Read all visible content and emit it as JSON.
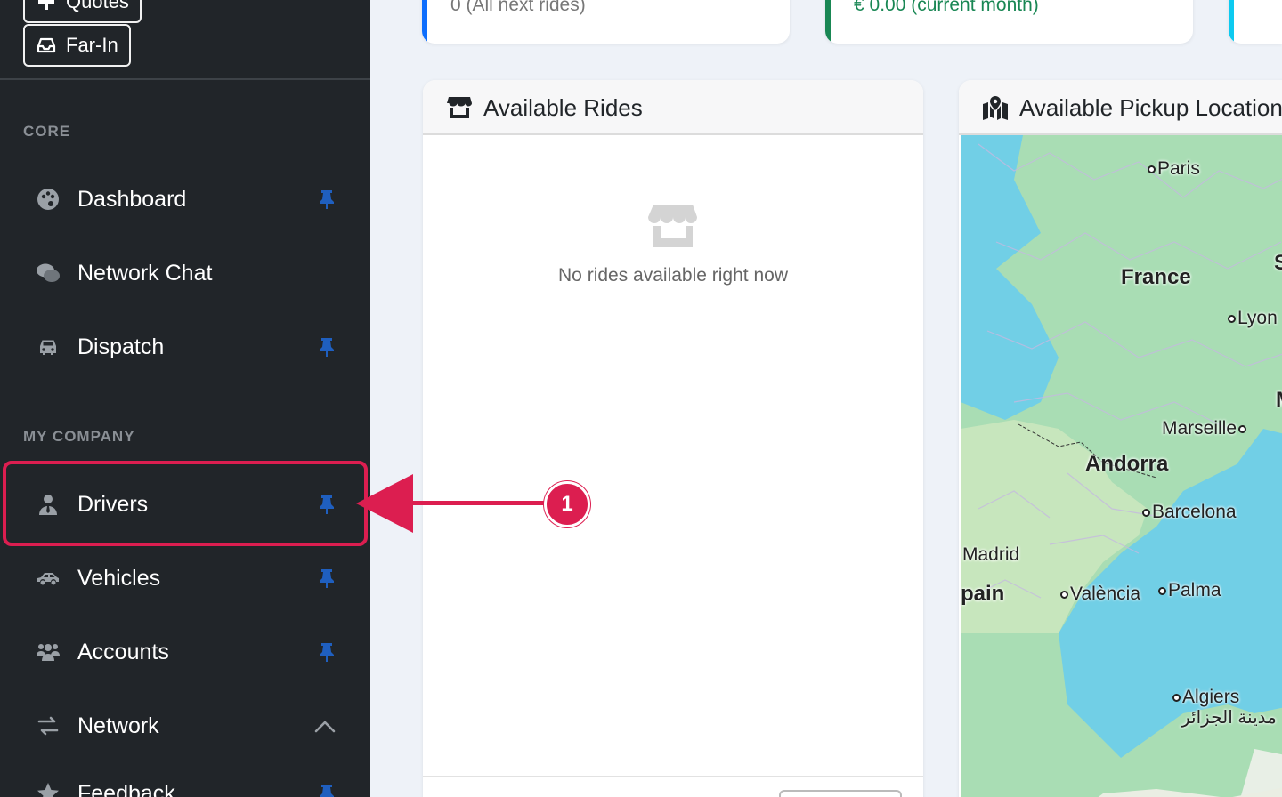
{
  "sidebar": {
    "top_buttons": [
      {
        "label": "Quotes",
        "icon": "plus-icon"
      },
      {
        "label": "Far-In",
        "icon": "inbox-icon"
      }
    ],
    "sections": [
      {
        "heading": "CORE"
      },
      {
        "heading": "MY COMPANY"
      }
    ],
    "items": [
      {
        "label": "Dashboard",
        "icon": "palette-icon",
        "pinned": true
      },
      {
        "label": "Network Chat",
        "icon": "comments-icon",
        "pinned": false
      },
      {
        "label": "Dispatch",
        "icon": "car-icon",
        "pinned": true
      },
      {
        "label": "Drivers",
        "icon": "user-tie-icon",
        "pinned": true
      },
      {
        "label": "Vehicles",
        "icon": "car-side-icon",
        "pinned": true
      },
      {
        "label": "Accounts",
        "icon": "users-icon",
        "pinned": true
      },
      {
        "label": "Network",
        "icon": "arrows-exchange-icon",
        "expanded": true
      },
      {
        "label": "Feedback",
        "icon": "star-icon",
        "pinned": true
      }
    ]
  },
  "stats": [
    {
      "text": "0 (All next rides)",
      "accent": "#0d6efd"
    },
    {
      "text": "€ 0.00 (current month)",
      "accent": "#198754"
    },
    {
      "text": "",
      "accent": "#0dcaf0"
    }
  ],
  "rides_card": {
    "title": "Available Rides",
    "icon": "store-icon",
    "empty_text": "No rides available right now"
  },
  "map_card": {
    "title": "Available Pickup Locations",
    "icon": "map-marked-icon",
    "labels": [
      {
        "text": "Paris",
        "dot": true
      },
      {
        "text": "France",
        "dot": false
      },
      {
        "text": "Lyon",
        "dot": true
      },
      {
        "text": "Marseille",
        "dot": true
      },
      {
        "text": "Andorra",
        "dot": false
      },
      {
        "text": "Barcelona",
        "dot": true
      },
      {
        "text": "Madrid",
        "dot": false
      },
      {
        "text": "pain",
        "dot": false
      },
      {
        "text": "València",
        "dot": true
      },
      {
        "text": "Palma",
        "dot": true
      },
      {
        "text": "Algiers",
        "dot": true
      },
      {
        "text": "مدينة الجزائر",
        "dot": false
      },
      {
        "text": "S",
        "dot": false
      },
      {
        "text": "M",
        "dot": false
      }
    ]
  },
  "annotation": {
    "step": "1",
    "color": "#dc1e50"
  }
}
